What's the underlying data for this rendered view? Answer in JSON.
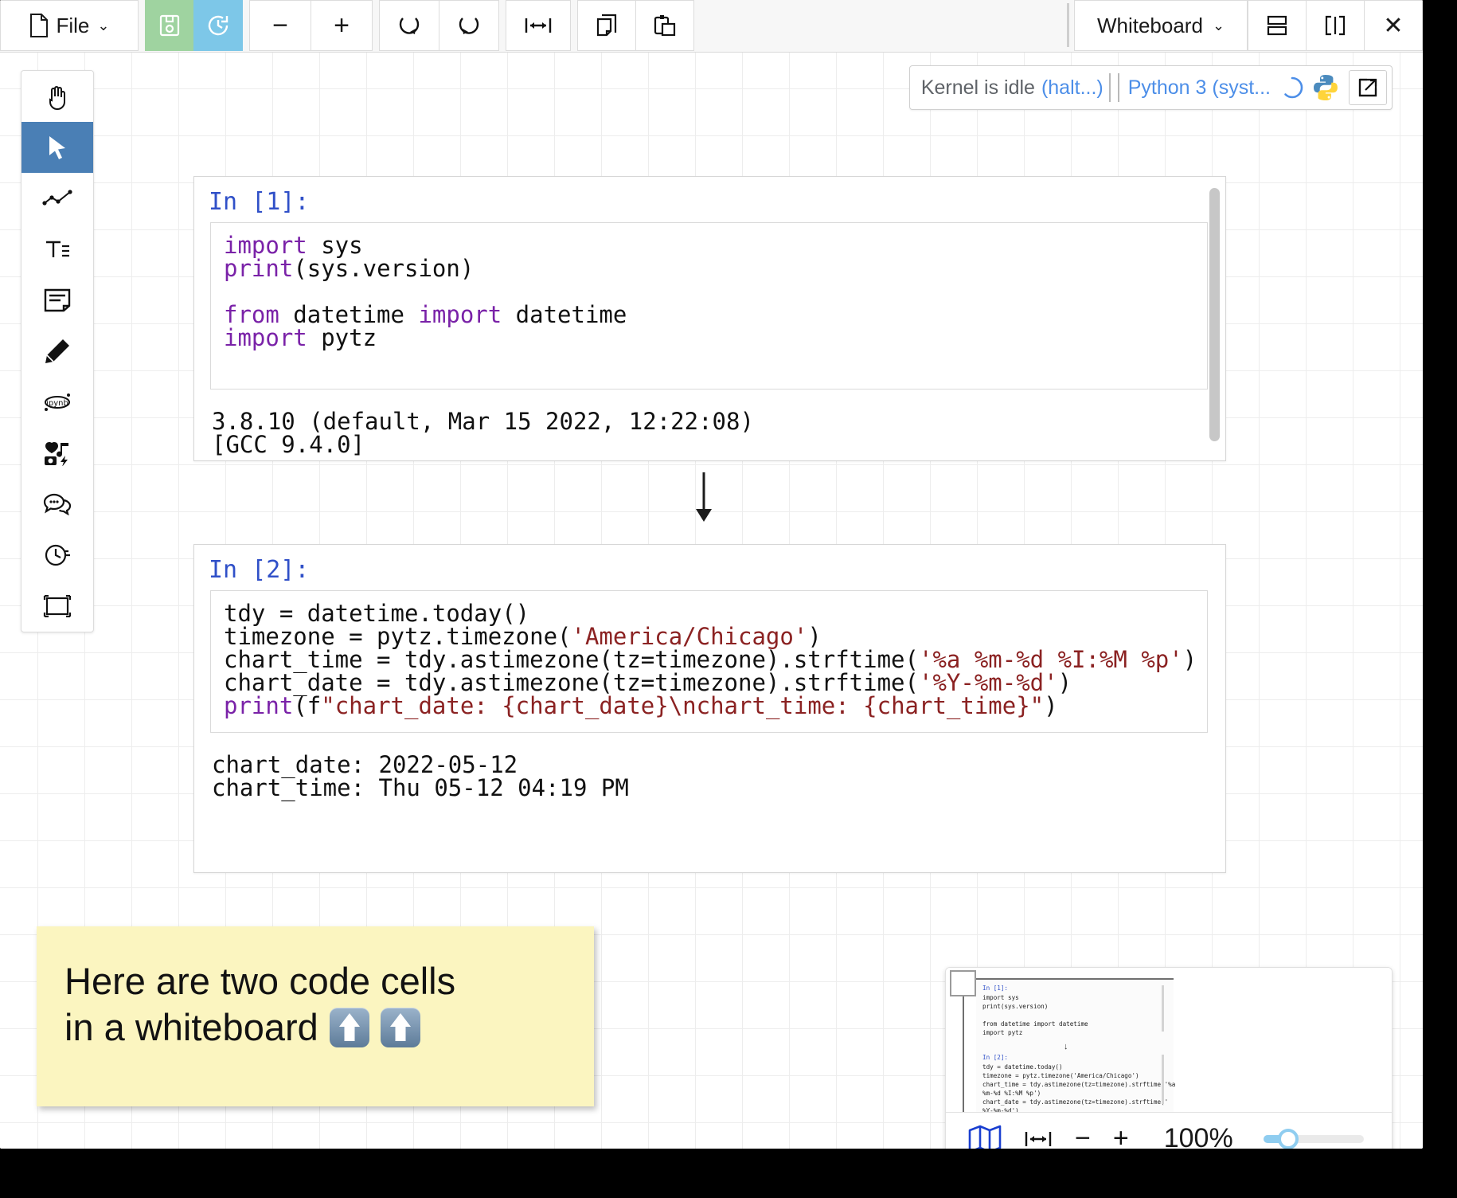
{
  "toolbar": {
    "file_label": "File",
    "file_icon": "document-icon",
    "save_icon": "floppy-save-icon",
    "history_icon": "clock-history-icon",
    "zoom_out_label": "−",
    "zoom_in_label": "+",
    "undo_icon": "undo-arrow-icon",
    "redo_icon": "redo-arrow-icon",
    "fit_width_icon": "fit-width-icon",
    "copy_icon": "copy-pages-icon",
    "paste_icon": "clipboard-paste-icon",
    "whiteboard_label": "Whiteboard",
    "split_horizontal_icon": "split-horizontal-icon",
    "split_vertical_icon": "split-vertical-icon",
    "close_label": "✕"
  },
  "kernel": {
    "status_text": "Kernel is idle",
    "halt_text": "(halt...)",
    "kernel_name": "Python 3 (syst...",
    "spinner_icon": "spinner-icon",
    "python_logo_icon": "python-logo-icon",
    "external_link_icon": "external-link-icon"
  },
  "palette": {
    "items": [
      {
        "name": "hand-pan-tool",
        "icon": "hand-icon",
        "active": false
      },
      {
        "name": "select-tool",
        "icon": "cursor-arrow-icon",
        "active": true
      },
      {
        "name": "edge-tool",
        "icon": "polyline-icon",
        "active": false
      },
      {
        "name": "text-tool",
        "icon": "text-icon",
        "active": false
      },
      {
        "name": "note-tool",
        "icon": "sticky-note-icon",
        "active": false
      },
      {
        "name": "pen-tool",
        "icon": "pencil-icon",
        "active": false
      },
      {
        "name": "ipynb-tool",
        "icon": "ipynb-icon",
        "active": false
      },
      {
        "name": "media-tool",
        "icon": "media-icon",
        "active": false
      },
      {
        "name": "chat-tool",
        "icon": "chat-bubble-icon",
        "active": false
      },
      {
        "name": "timer-tool",
        "icon": "stopwatch-icon",
        "active": false
      },
      {
        "name": "frame-tool",
        "icon": "frame-icon",
        "active": false
      }
    ]
  },
  "cells": [
    {
      "prompt": "In [1]:",
      "code_lines": [
        [
          {
            "t": "import",
            "c": "kw"
          },
          {
            "t": " sys",
            "c": ""
          }
        ],
        [
          {
            "t": "print",
            "c": "kw"
          },
          {
            "t": "(sys.version)",
            "c": ""
          }
        ],
        [
          {
            "t": "",
            "c": ""
          }
        ],
        [
          {
            "t": "from",
            "c": "kw"
          },
          {
            "t": " datetime ",
            "c": ""
          },
          {
            "t": "import",
            "c": "kw"
          },
          {
            "t": " datetime",
            "c": ""
          }
        ],
        [
          {
            "t": "import",
            "c": "kw"
          },
          {
            "t": " pytz",
            "c": ""
          }
        ]
      ],
      "output": "3.8.10 (default, Mar 15 2022, 12:22:08)\n[GCC 9.4.0]"
    },
    {
      "prompt": "In [2]:",
      "code_lines": [
        [
          {
            "t": "tdy = datetime.today()",
            "c": ""
          }
        ],
        [
          {
            "t": "timezone = pytz.timezone(",
            "c": ""
          },
          {
            "t": "'America/Chicago'",
            "c": "str"
          },
          {
            "t": ")",
            "c": ""
          }
        ],
        [
          {
            "t": "chart_time = tdy.astimezone(tz=timezone).strftime(",
            "c": ""
          },
          {
            "t": "'%a %m-%d %I:%M %p'",
            "c": "str"
          },
          {
            "t": ")",
            "c": ""
          }
        ],
        [
          {
            "t": "chart_date = tdy.astimezone(tz=timezone).strftime(",
            "c": ""
          },
          {
            "t": "'%Y-%m-%d'",
            "c": "str"
          },
          {
            "t": ")",
            "c": ""
          }
        ],
        [
          {
            "t": "print",
            "c": "kw"
          },
          {
            "t": "(f",
            "c": ""
          },
          {
            "t": "\"chart_date: {chart_date}\\nchart_time: {chart_time}\"",
            "c": "str"
          },
          {
            "t": ")",
            "c": ""
          }
        ]
      ],
      "output": "chart_date: 2022-05-12\nchart_time: Thu 05-12 04:19 PM"
    }
  ],
  "sticky_note": {
    "line1": "Here are two code cells",
    "line2": "in a whiteboard",
    "emoji": "⬆️",
    "background_color": "#fbf5c0"
  },
  "minimap": {
    "map_icon": "map-icon",
    "fit_width_icon": "fit-width-icon",
    "zoom_out_label": "−",
    "zoom_in_label": "+",
    "zoom_level": "100%",
    "thumb_text_1": "In [1]:",
    "thumb_code_1": "import sys\nprint(sys.version)\n\nfrom datetime import datetime\nimport pytz",
    "thumb_text_2": "In [2]:",
    "thumb_code_2": "tdy = datetime.today()\ntimezone = pytz.timezone('America/Chicago')\nchart_time = tdy.astimezone(tz=timezone).strftime('%a\n%m-%d %I:%M %p')\nchart_date = tdy.astimezone(tz=timezone).strftime('\n%Y-%m-%d')\nprint(f\"chart_date: {chart_date}\\nchart_time:\n{chart_time}\")"
  },
  "colors": {
    "accent_blue": "#4c8ee8",
    "prompt_blue": "#3050c8",
    "keyword_purple": "#7a22a8",
    "string_red": "#8b2222",
    "save_green": "#9fd3a0",
    "history_blue": "#7dc7e8",
    "select_active": "#4a7fb5"
  }
}
